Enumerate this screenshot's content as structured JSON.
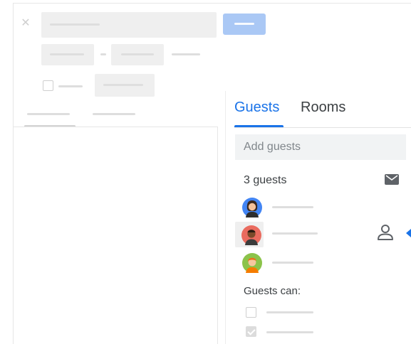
{
  "panel": {
    "tabs": [
      {
        "label": "Guests",
        "active": true
      },
      {
        "label": "Rooms",
        "active": false
      }
    ],
    "add_guests_placeholder": "Add guests",
    "guest_count": "3 guests",
    "guests_can": "Guests can:",
    "permissions": [
      {
        "checked": false
      },
      {
        "checked": true
      }
    ]
  },
  "icons": {
    "close": "close-icon",
    "mail": "mail-icon",
    "person": "person-icon"
  },
  "colors": {
    "accent": "#1a73e8",
    "save_button": "#aac8f5",
    "placeholder": "#efefef"
  }
}
